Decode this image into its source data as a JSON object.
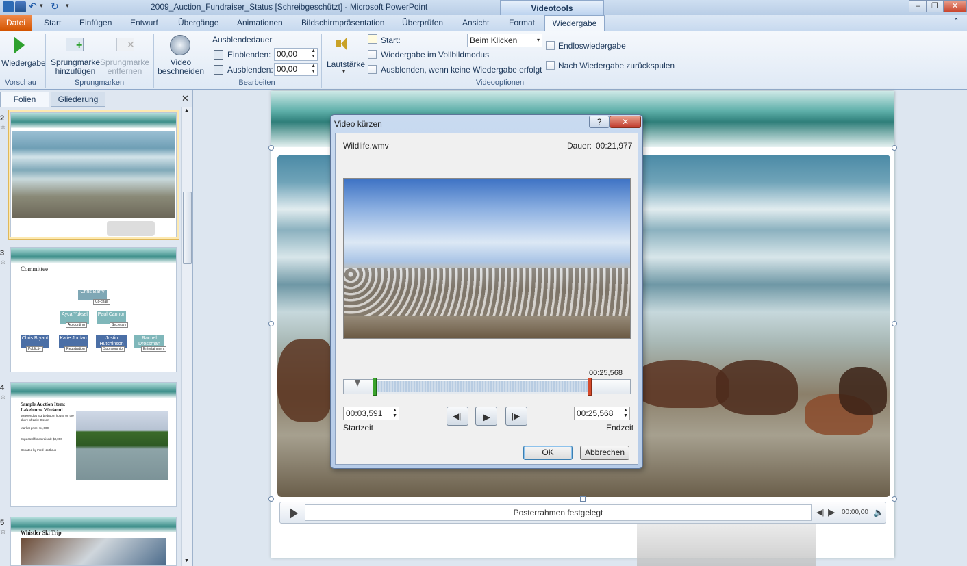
{
  "window": {
    "title": "2009_Auction_Fundraiser_Status [Schreibgeschützt]  -  Microsoft PowerPoint",
    "context_group": "Videotools"
  },
  "tabs": {
    "file": "Datei",
    "items": [
      "Start",
      "Einfügen",
      "Entwurf",
      "Übergänge",
      "Animationen",
      "Bildschirmpräsentation",
      "Überprüfen",
      "Ansicht",
      "Format"
    ],
    "active": "Wiedergabe"
  },
  "ribbon": {
    "preview": {
      "play_label": "Wiedergabe",
      "group": "Vorschau"
    },
    "bookmarks": {
      "add": "Sprungmarke hinzufügen",
      "remove": "Sprungmarke entfernen",
      "group": "Sprungmarken"
    },
    "edit": {
      "trim": "Video beschneiden",
      "fade_title": "Ausblendedauer",
      "fade_in_label": "Einblenden:",
      "fade_in_value": "00,00",
      "fade_out_label": "Ausblenden:",
      "fade_out_value": "00,00",
      "group": "Bearbeiten"
    },
    "options": {
      "volume": "Lautstärke",
      "start_label": "Start:",
      "start_value": "Beim Klicken",
      "fullscreen": "Wiedergabe im Vollbildmodus",
      "hide": "Ausblenden, wenn keine Wiedergabe erfolgt",
      "loop": "Endloswiedergabe",
      "rewind": "Nach Wiedergabe zurückspulen",
      "group": "Videooptionen"
    }
  },
  "left_pane": {
    "tab_slides": "Folien",
    "tab_outline": "Gliederung",
    "slides": [
      {
        "number": "2"
      },
      {
        "number": "3",
        "title": "Committee",
        "org": [
          "Chris Barry",
          "Co-chair",
          "Ayca Yuksel",
          "Accounting",
          "Paul Cannon",
          "Secretary",
          "Chris Bryant",
          "Publicity",
          "Katie Jordan",
          "Registration",
          "Justin Hutchinson",
          "Sponsorship",
          "Rachel Drossman",
          "Entertainment"
        ]
      },
      {
        "number": "4",
        "title": "Sample Auction Item: Lakehouse Weekend",
        "bullets": [
          "Weekend at a 3 bedroom house on the shore of Lake Ossen",
          "Market price: $4,000",
          "Expected funds raised: $3,000",
          "Donated by Fred Northrup"
        ]
      },
      {
        "number": "5",
        "title": "Whistler Ski Trip"
      }
    ]
  },
  "player": {
    "status": "Posterrahmen festgelegt",
    "time": "00:00,00"
  },
  "dialog": {
    "title": "Video kürzen",
    "help": "?",
    "filename": "Wildlife.wmv",
    "duration_label": "Dauer:",
    "duration_value": "00:21,977",
    "end_marker_time": "00:25,568",
    "start_time": "00:03,591",
    "start_label": "Startzeit",
    "end_time": "00:25,568",
    "end_label": "Endzeit",
    "ok": "OK",
    "cancel": "Abbrechen"
  },
  "colors": {
    "file_tab": "#d35400",
    "accent": "#1e395b",
    "start_marker": "#3aa32b",
    "end_marker": "#d64a2a"
  }
}
